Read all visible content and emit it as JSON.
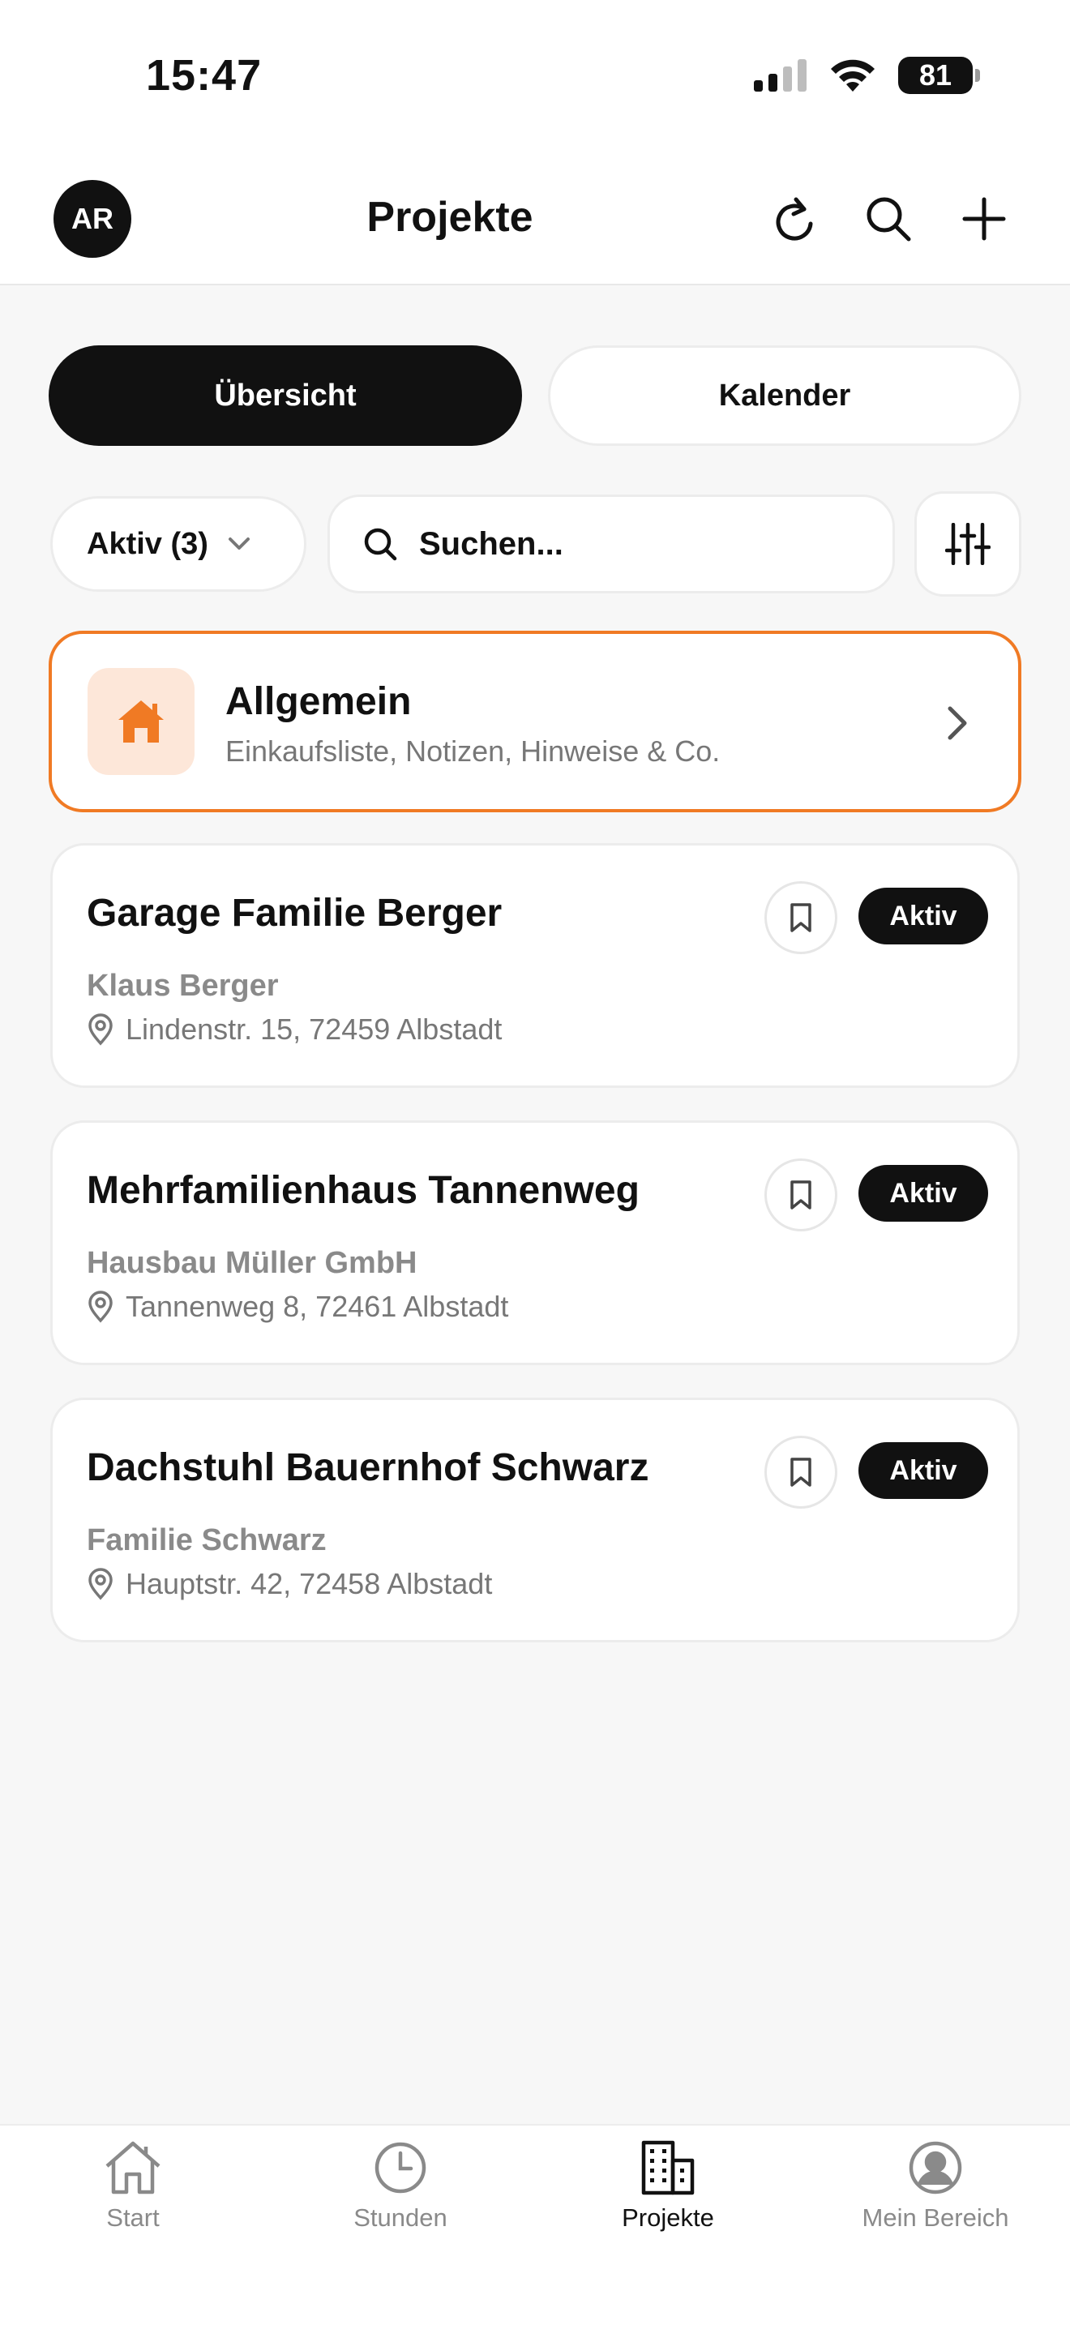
{
  "status_bar": {
    "time": "15:47",
    "battery": "81"
  },
  "header": {
    "avatar_initials": "AR",
    "title": "Projekte"
  },
  "tabs": [
    {
      "label": "Übersicht",
      "active": true
    },
    {
      "label": "Kalender",
      "active": false
    }
  ],
  "filters": {
    "status_label": "Aktiv (3)",
    "search_placeholder": "Suchen..."
  },
  "general": {
    "title": "Allgemein",
    "subtitle": "Einkaufsliste, Notizen, Hinweise & Co.",
    "accent": "#f07a24",
    "icon_bg": "#fde7d9"
  },
  "projects": [
    {
      "title": "Garage Familie Berger",
      "client": "Klaus Berger",
      "address": "Lindenstr. 15, 72459 Albstadt",
      "status": "Aktiv"
    },
    {
      "title": "Mehrfamilienhaus Tannenweg",
      "client": "Hausbau Müller GmbH",
      "address": "Tannenweg 8, 72461 Albstadt",
      "status": "Aktiv"
    },
    {
      "title": "Dachstuhl Bauernhof Schwarz",
      "client": "Familie Schwarz",
      "address": "Hauptstr. 42, 72458 Albstadt",
      "status": "Aktiv"
    }
  ],
  "bottom_nav": [
    {
      "label": "Start",
      "icon": "home-icon",
      "active": false
    },
    {
      "label": "Stunden",
      "icon": "clock-icon",
      "active": false
    },
    {
      "label": "Projekte",
      "icon": "building-icon",
      "active": true
    },
    {
      "label": "Mein Bereich",
      "icon": "user-circle-icon",
      "active": false
    }
  ]
}
